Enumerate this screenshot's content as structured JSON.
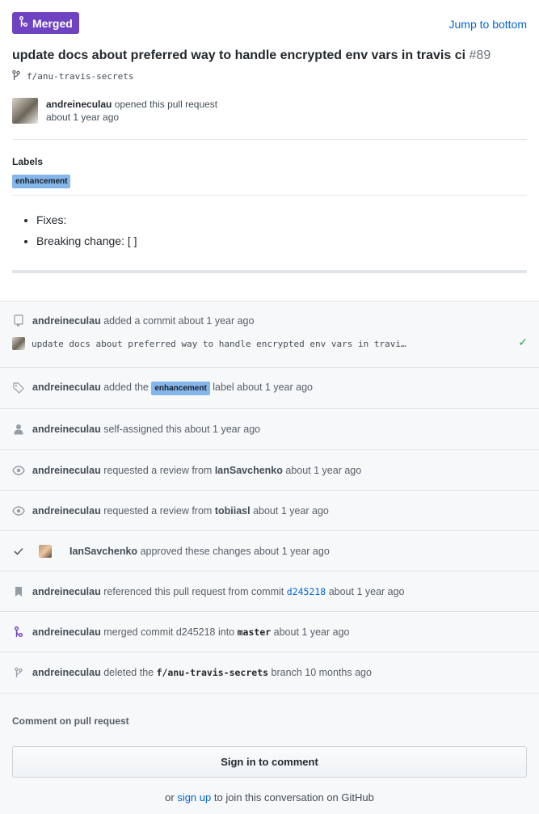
{
  "header": {
    "status_badge": "Merged",
    "jump_link": "Jump to bottom",
    "title": "update docs about preferred way to handle encrypted env vars in travis ci",
    "number": "#89",
    "branch": "f/anu-travis-secrets"
  },
  "author": {
    "name": "andreineculau",
    "action": "opened this pull request",
    "time": "about 1 year ago"
  },
  "labels": {
    "heading": "Labels",
    "items": [
      "enhancement"
    ]
  },
  "body": {
    "bullets": [
      "Fixes:",
      "Breaking change: [ ]"
    ]
  },
  "timeline": {
    "commit": {
      "user": "andreineculau",
      "action": "added a commit about 1 year ago",
      "message": "update docs about preferred way to handle encrypted env vars in travi…"
    },
    "label_event": {
      "user": "andreineculau",
      "pre": "added the",
      "label": "enhancement",
      "post": "label about 1 year ago"
    },
    "assign_event": {
      "user": "andreineculau",
      "text": "self-assigned this about 1 year ago"
    },
    "review_request_1": {
      "user": "andreineculau",
      "pre": "requested a review from",
      "reviewer": "IanSavchenko",
      "post": "about 1 year ago"
    },
    "review_request_2": {
      "user": "andreineculau",
      "pre": "requested a review from",
      "reviewer": "tobiiasl",
      "post": "about 1 year ago"
    },
    "approval": {
      "user": "IanSavchenko",
      "text": "approved these changes about 1 year ago"
    },
    "reference": {
      "user": "andreineculau",
      "pre": "referenced this pull request from commit",
      "sha": "d245218",
      "post": "about 1 year ago"
    },
    "merge": {
      "user": "andreineculau",
      "pre": "merged commit d245218 into",
      "target": "master",
      "post": "about 1 year ago"
    },
    "delete_branch": {
      "user": "andreineculau",
      "pre": "deleted the",
      "branch": "f/anu-travis-secrets",
      "post": "branch 10 months ago"
    }
  },
  "comment": {
    "heading": "Comment on pull request",
    "sign_in_button": "Sign in to comment",
    "or": "or",
    "sign_up": "sign up",
    "suffix": "to join this conversation on GitHub"
  },
  "colors": {
    "merged_purple": "#6f42c1",
    "link_blue": "#0366d6",
    "label_blue": "#84b6eb",
    "check_green": "#28a745"
  }
}
